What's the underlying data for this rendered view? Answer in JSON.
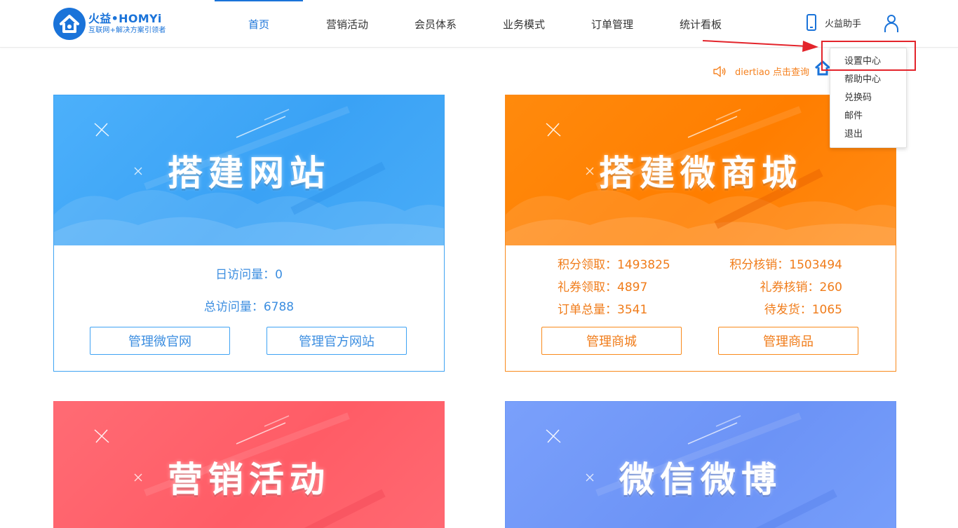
{
  "header": {
    "logo_main": "火益•HOMYi",
    "logo_sub": "互联网+解决方案引领者",
    "nav": [
      {
        "label": "首页",
        "active": true
      },
      {
        "label": "营销活动",
        "active": false
      },
      {
        "label": "会员体系",
        "active": false
      },
      {
        "label": "业务模式",
        "active": false
      },
      {
        "label": "订单管理",
        "active": false
      },
      {
        "label": "统计看板",
        "active": false
      }
    ],
    "assistant_label": "火益助手",
    "brand_color": "#1a73d9"
  },
  "dropdown": {
    "items": [
      "设置中心",
      "帮助中心",
      "兑换码",
      "邮件",
      "退出"
    ],
    "highlighted": "设置中心",
    "highlight_color": "#e3242b"
  },
  "notice": {
    "text": "diertiao 点击查询"
  },
  "cards": {
    "website": {
      "title": "搭建网站",
      "daily_visits": "日访问量：0",
      "total_visits": "总访问量：6788",
      "btn1": "管理微官网",
      "btn2": "管理官方网站",
      "color": "#3fa3f3"
    },
    "mall": {
      "title": "搭建微商城",
      "points_claimed": "积分领取：1493825",
      "points_verified": "积分核销：1503494",
      "coupons_claimed": "礼券领取：4897",
      "coupons_verified": "礼券核销：260",
      "orders_total": "订单总量：3541",
      "pending_shipment": "待发货：1065",
      "btn1": "管理商城",
      "btn2": "管理商品",
      "color": "#f98a1c"
    },
    "marketing": {
      "title": "营销活动",
      "color": "#ff6470"
    },
    "weibo": {
      "title": "微信微博",
      "color": "#6a96f5"
    }
  }
}
